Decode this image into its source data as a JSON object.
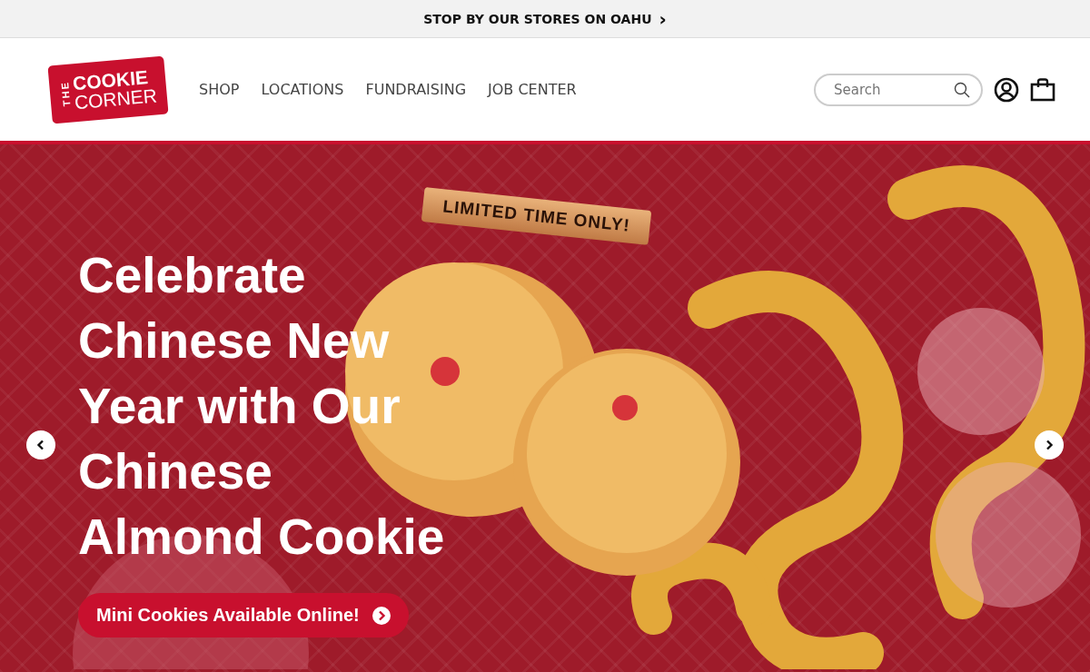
{
  "announcement": {
    "text": "STOP BY OUR STORES ON OAHU",
    "arrow": "›"
  },
  "logo": {
    "top": "THE",
    "line_1": "COOKIE",
    "line_2": "CORNER"
  },
  "nav": [
    {
      "label": "SHOP"
    },
    {
      "label": "LOCATIONS"
    },
    {
      "label": "FUNDRAISING"
    },
    {
      "label": "JOB CENTER"
    }
  ],
  "search": {
    "placeholder": "Search"
  },
  "hero": {
    "ribbon": "LIMITED TIME ONLY!",
    "headline": [
      "Celebrate",
      "Chinese New",
      "Year with Our",
      "Chinese",
      "Almond Cookie"
    ],
    "cta": "Mini Cookies Available Online!"
  }
}
